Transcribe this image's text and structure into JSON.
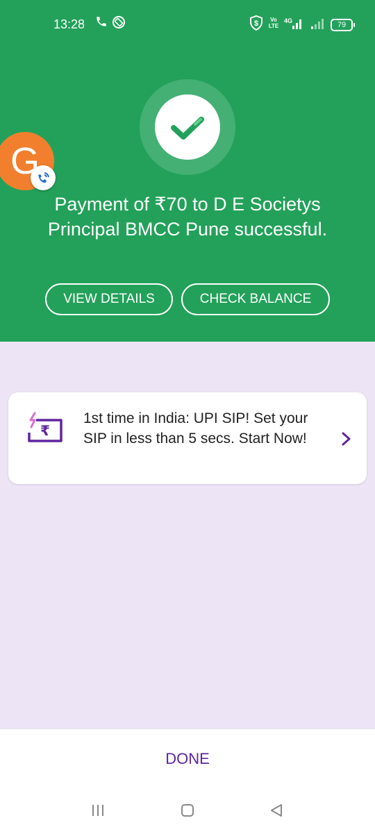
{
  "status_bar": {
    "time": "13:28",
    "network_tag": "Vo LTE",
    "network_gen": "4G",
    "battery": "79"
  },
  "avatar": {
    "letter": "G"
  },
  "payment": {
    "status": "success",
    "message": "Payment of ₹70 to D E Societys Principal BMCC Pune successful."
  },
  "actions": {
    "view_details": "VIEW DETAILS",
    "check_balance": "CHECK BALANCE"
  },
  "promo": {
    "icon": "rupee-card-icon",
    "text": "1st time in India: UPI SIP! Set your SIP in less than 5 secs. Start Now!"
  },
  "footer": {
    "done_label": "DONE"
  },
  "nav_bar": {
    "icons": [
      "menu-icon",
      "home-icon",
      "back-icon"
    ]
  },
  "colors": {
    "header_green": "#23a15a",
    "brand_purple": "#5f259f",
    "page_background": "#ede5f6",
    "avatar_orange": "#f27f2e"
  }
}
